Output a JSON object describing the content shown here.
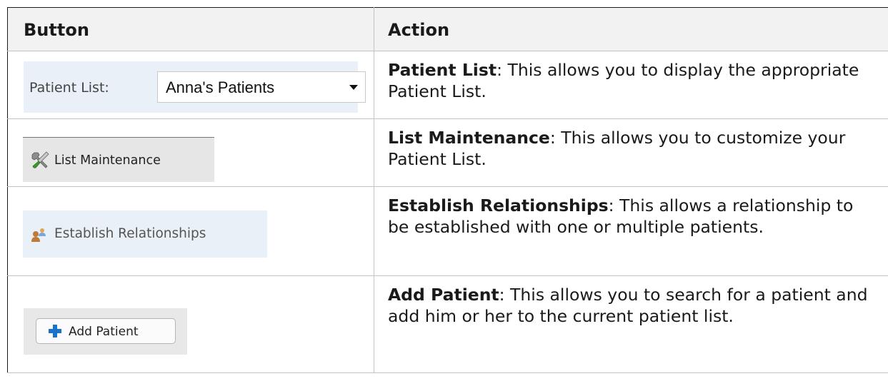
{
  "table": {
    "headers": [
      "Button",
      "Action"
    ],
    "rows": [
      {
        "term": "Patient List",
        "description": ": This allows you to display the appropriate Patient List."
      },
      {
        "term": "List Maintenance",
        "description": ": This allows you to customize your Patient List."
      },
      {
        "term": "Establish Relationships",
        "description": ": This allows a relationship to be established with one or multiple patients."
      },
      {
        "term": "Add Patient",
        "description": ": This allows you to search for a patient and add him or her to the current patient list."
      }
    ]
  },
  "widgets": {
    "patient_list": {
      "label": "Patient List:",
      "value": "Anna's Patients",
      "icon": "caret-down-icon"
    },
    "list_maintenance": {
      "label": "List Maintenance",
      "icon": "tools-icon"
    },
    "establish_relationships": {
      "label": "Establish Relationships",
      "icon": "relationship-icon"
    },
    "add_patient": {
      "label": "Add Patient",
      "icon": "plus-icon"
    }
  },
  "colors": {
    "plus_icon": "#1a73c9",
    "tool_green": "#3a9a2a",
    "widget_blue_bg": "#eaf0f8"
  }
}
